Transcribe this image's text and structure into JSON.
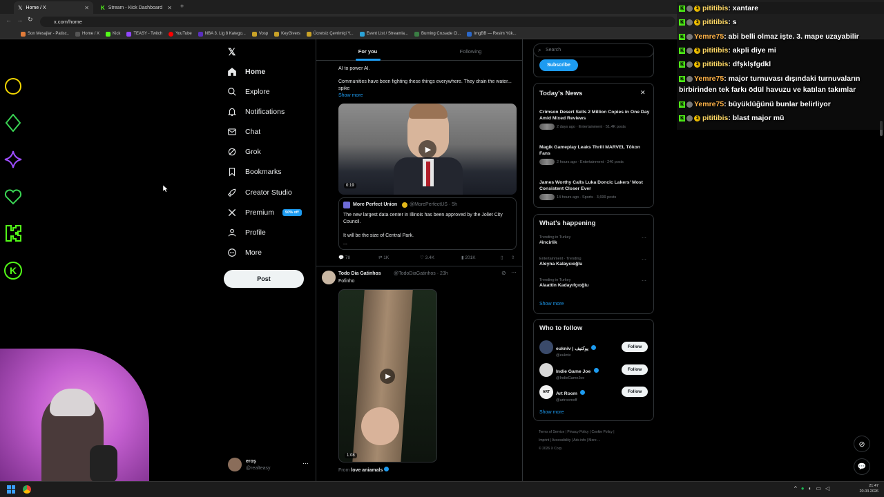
{
  "browser": {
    "tabs": [
      {
        "title": "Home / X",
        "active": true
      },
      {
        "title": "Stream - Kick Dashboard",
        "active": false
      }
    ],
    "url": "x.com/home",
    "bookmarks": [
      "Son Mesajlar - Patisc..",
      "Home / X",
      "Kick",
      "TEASY - Twitch",
      "YouTube",
      "NBA 3. Lig 8 Katego...",
      "Vosp",
      "KeyGivers",
      "Ücretsiz Çevrimiçi Y...",
      "Event List / Streamla...",
      "Burning Crusade Cl...",
      "ImgBB — Resim Yük..."
    ]
  },
  "nav": {
    "items": [
      {
        "label": "Home",
        "icon": "home-icon"
      },
      {
        "label": "Explore",
        "icon": "search-icon"
      },
      {
        "label": "Notifications",
        "icon": "bell-icon"
      },
      {
        "label": "Chat",
        "icon": "mail-icon"
      },
      {
        "label": "Grok",
        "icon": "grok-icon"
      },
      {
        "label": "Bookmarks",
        "icon": "bookmark-icon"
      },
      {
        "label": "Creator Studio",
        "icon": "rocket-icon"
      },
      {
        "label": "Premium",
        "icon": "x-logo-icon"
      },
      {
        "label": "Profile",
        "icon": "person-icon"
      },
      {
        "label": "More",
        "icon": "more-circle-icon"
      }
    ],
    "premium_badge": "50% off",
    "post_label": "Post",
    "account_name": "eroş",
    "account_handle": "@realteasy"
  },
  "feed": {
    "tab_for_you": "For you",
    "tab_following": "Following",
    "post1": {
      "text_top": "AI to power AI.",
      "text_body": "Communities have been fighting these things everywhere. They drain the water... spike",
      "show_more": "Show more",
      "video_duration": "0:19",
      "quote_author": "More Perfect Union",
      "quote_handle": "@MorePerfectUS · 5h",
      "quote_text1": "The new largest data center in Illinois has been approved by the Joliet City Council.",
      "quote_text2": "It will be the size of Central Park.",
      "quote_more": "...",
      "replies": "78",
      "reposts": "1K",
      "likes": "3.4K",
      "views": "201K"
    },
    "post2": {
      "author": "Todo Dia Gatinhos",
      "handle": "@TodoDiaGatinhos · 23h",
      "text": "Fofinho",
      "video_duration": "1:08",
      "from_label": "From",
      "from_account": "love aniamals"
    }
  },
  "sidebar": {
    "search_placeholder": "Search",
    "subscribe_label": "Subscribe",
    "todays_news_title": "Today's News",
    "news": [
      {
        "title": "Crimson Desert Sells 2 Million Copies in One Day Amid Mixed Reviews",
        "meta": "2 days ago · Entertainment · 51.4K posts"
      },
      {
        "title": "Magik Gameplay Leaks Thrill MARVEL Tōkon Fans",
        "meta": "2 hours ago · Entertainment · 246 posts"
      },
      {
        "title": "James Worthy Calls Luka Doncic Lakers' Most Consistent Closer Ever",
        "meta": "14 hours ago · Sports · 3,699 posts"
      }
    ],
    "happening_title": "What's happening",
    "trends": [
      {
        "context": "Trending in Turkey",
        "name": "#incirlik"
      },
      {
        "context": "Entertainment · Trending",
        "name": "Aleyna Kalaycıoğlu"
      },
      {
        "context": "Trending in Turkey",
        "name": "Alaattin Kadayıfçıoğlu"
      }
    ],
    "show_more": "Show more",
    "who_to_follow_title": "Who to follow",
    "follow": [
      {
        "name": "eukniv | يوكنيف",
        "handle": "@eukniv"
      },
      {
        "name": "Indie Game Joe",
        "handle": "@IndieGameJoe"
      },
      {
        "name": "Art Room",
        "handle": "@artroomoff"
      }
    ],
    "follow_label": "Follow",
    "footer": [
      "Terms of Service",
      "Privacy Policy",
      "Cookie Policy",
      "Imprint",
      "Accessibility",
      "Ads info",
      "More ...",
      "© 2026 X Corp."
    ]
  },
  "chat": [
    {
      "user": "pititibis",
      "msg": ": xantare"
    },
    {
      "user": "pititibis",
      "msg": ": s"
    },
    {
      "user": "Yemre75",
      "msg": ": abi belli olmaz işte. 3. mape uzayabilir"
    },
    {
      "user": "pititibis",
      "msg": ": akpli diye mi"
    },
    {
      "user": "pititibis",
      "msg": ": dfşklşfgdkl"
    },
    {
      "user": "Yemre75",
      "msg": ": major turnuvası dışındaki turnuvaların birbirinden tek farkı ödül havuzu ve katılan takımlar"
    },
    {
      "user": "Yemre75",
      "msg": ": büyüklüğünü bunlar belirliyor"
    },
    {
      "user": "pititibis",
      "msg": ": blast major mü"
    }
  ],
  "taskbar": {
    "time": "21:47",
    "date": "20.03.2026"
  },
  "colors": {
    "x_blue": "#1d9bf0",
    "kick_green": "#53fc18",
    "chat_user_orange": "#ffd966",
    "accent_purple": "#9d4dff"
  }
}
